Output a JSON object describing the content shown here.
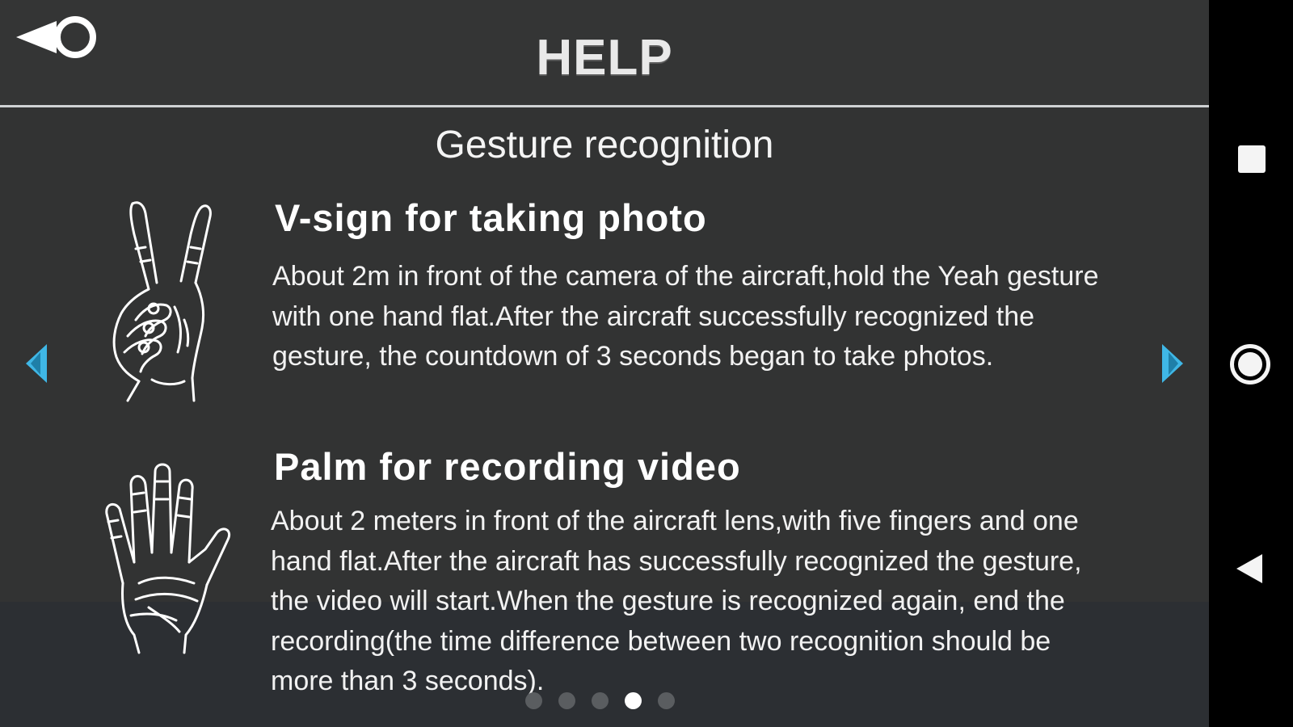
{
  "header": {
    "title": "HELP",
    "back_icon": "back-circle-icon"
  },
  "section": {
    "title": "Gesture recognition"
  },
  "items": [
    {
      "heading": "V-sign for taking photo",
      "icon": "v-sign-hand-icon",
      "lines": [
        "About 2m in front of the camera of the aircraft,hold the Yeah gesture",
        "with one hand flat.After the aircraft successfully recognized the",
        "gesture, the countdown of 3 seconds began to take photos."
      ]
    },
    {
      "heading": "Palm for recording video",
      "icon": "open-palm-hand-icon",
      "lines": [
        "About 2 meters in front of the aircraft lens,with five fingers and one",
        "hand flat.After the aircraft has successfully recognized the gesture,",
        "the video will start.When the gesture is recognized again, end the",
        "recording(the time difference between two recognition should be",
        "more than 3 seconds)."
      ]
    }
  ],
  "pager": {
    "total": 5,
    "active_index": 3
  },
  "colors": {
    "background": "#323333",
    "arrow": "#3fb7e6",
    "divider": "#cfd2d4",
    "text": "#ffffff"
  },
  "system_nav": {
    "buttons": [
      "recents-square-icon",
      "home-circle-icon",
      "back-triangle-icon"
    ]
  }
}
